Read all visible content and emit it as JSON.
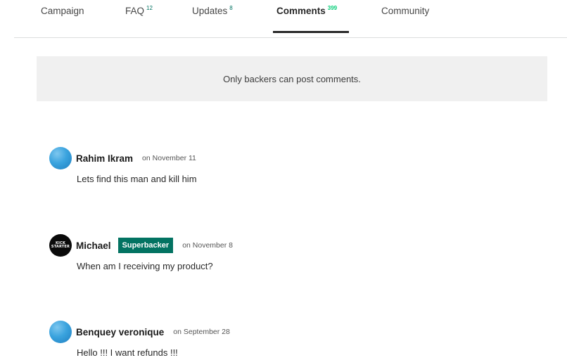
{
  "tabs": [
    {
      "label": "Campaign",
      "count": ""
    },
    {
      "label": "FAQ",
      "count": "12"
    },
    {
      "label": "Updates",
      "count": "8"
    },
    {
      "label": "Comments",
      "count": "399"
    },
    {
      "label": "Community",
      "count": ""
    }
  ],
  "active_tab": "Comments",
  "notice": {
    "text": "Only backers can post comments."
  },
  "comments": [
    {
      "author": "Rahim Ikram",
      "badge": "",
      "date": "on November 11",
      "body": "Lets find this man and kill him",
      "avatar": "blue-circle"
    },
    {
      "author": "Michael",
      "badge": "Superbacker",
      "date": "on November 8",
      "body": "When am I receiving my product?",
      "avatar": "kickstarter-logo",
      "avatar_text": [
        "KICK",
        "STARTER"
      ]
    },
    {
      "author": "Benquey veronique",
      "badge": "",
      "date": "on September 28",
      "body": "Hello !!! I want refunds !!!",
      "avatar": "blue-circle"
    }
  ],
  "colors": {
    "accent": "#037362",
    "count_active": "#05ce78",
    "notice_bg": "#f0f0f0",
    "avatar_blue": "#3aa3de"
  }
}
